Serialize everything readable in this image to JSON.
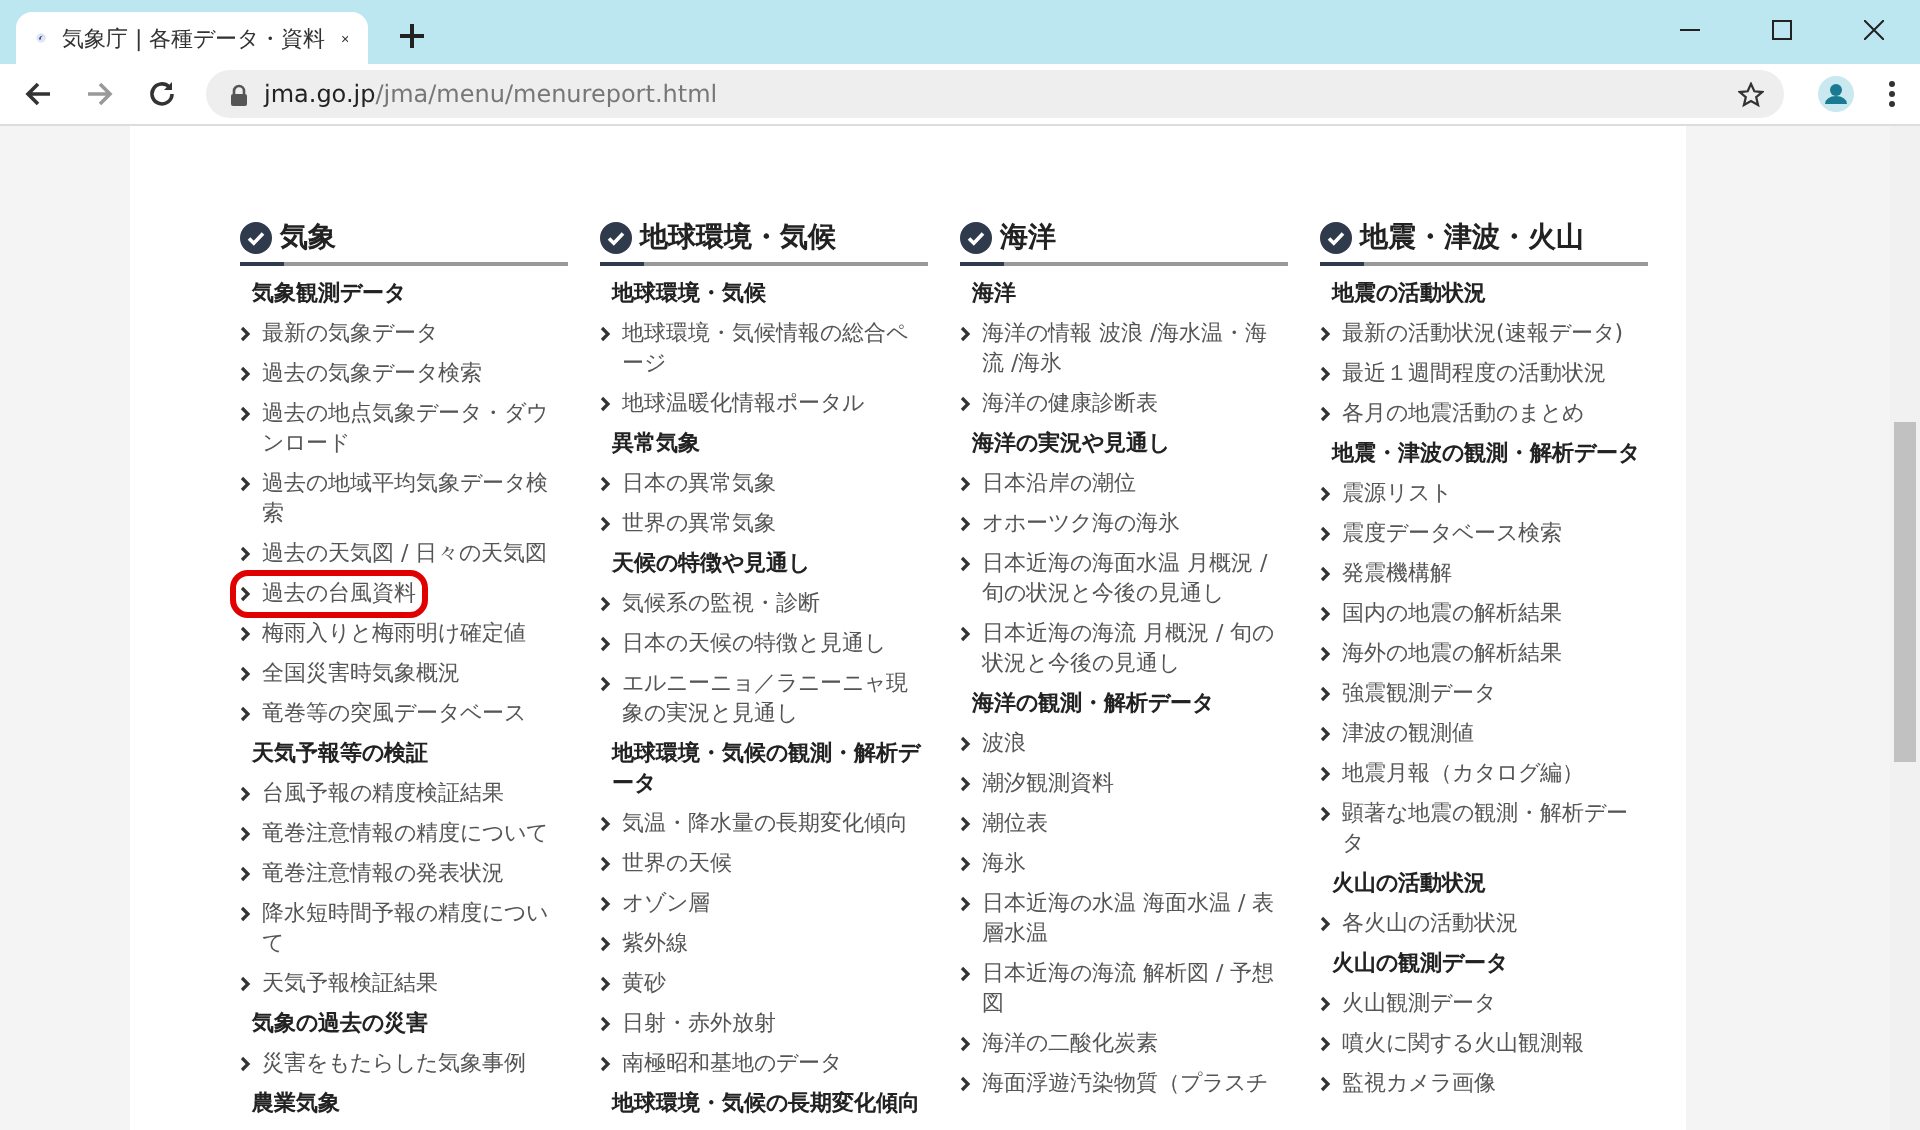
{
  "browser": {
    "tab": {
      "title": "気象庁 | 各種データ・資料",
      "selected": true
    },
    "url_host": "jma.go.jp",
    "url_path": "/jma/menu/menureport.html"
  },
  "sections": [
    {
      "title": "気象",
      "items": [
        {
          "kind": "heading",
          "text": "気象観測データ"
        },
        {
          "kind": "link",
          "text": "最新の気象データ",
          "highlighted": false
        },
        {
          "kind": "link",
          "text": "過去の気象データ検索",
          "highlighted": false
        },
        {
          "kind": "link",
          "text": "過去の地点気象データ・ダウンロード",
          "highlighted": false
        },
        {
          "kind": "link",
          "text": "過去の地域平均気象データ検索",
          "highlighted": false
        },
        {
          "kind": "link",
          "text": "過去の天気図 / 日々の天気図",
          "highlighted": false
        },
        {
          "kind": "link",
          "text": "過去の台風資料",
          "highlighted": true
        },
        {
          "kind": "link",
          "text": "梅雨入りと梅雨明け確定値",
          "highlighted": false
        },
        {
          "kind": "link",
          "text": "全国災害時気象概況",
          "highlighted": false
        },
        {
          "kind": "link",
          "text": "竜巻等の突風データベース",
          "highlighted": false
        },
        {
          "kind": "heading",
          "text": "天気予報等の検証"
        },
        {
          "kind": "link",
          "text": "台風予報の精度検証結果",
          "highlighted": false
        },
        {
          "kind": "link",
          "text": "竜巻注意情報の精度について",
          "highlighted": false
        },
        {
          "kind": "link",
          "text": "竜巻注意情報の発表状況",
          "highlighted": false
        },
        {
          "kind": "link",
          "text": "降水短時間予報の精度について",
          "highlighted": false
        },
        {
          "kind": "link",
          "text": "天気予報検証結果",
          "highlighted": false
        },
        {
          "kind": "heading",
          "text": "気象の過去の災害"
        },
        {
          "kind": "link",
          "text": "災害をもたらした気象事例",
          "highlighted": false
        },
        {
          "kind": "heading",
          "text": "農業気象"
        }
      ]
    },
    {
      "title": "地球環境・気候",
      "items": [
        {
          "kind": "heading",
          "text": "地球環境・気候"
        },
        {
          "kind": "link",
          "text": "地球環境・気候情報の総合ページ",
          "highlighted": false
        },
        {
          "kind": "link",
          "text": "地球温暖化情報ポータル",
          "highlighted": false
        },
        {
          "kind": "heading",
          "text": "異常気象"
        },
        {
          "kind": "link",
          "text": "日本の異常気象",
          "highlighted": false
        },
        {
          "kind": "link",
          "text": "世界の異常気象",
          "highlighted": false
        },
        {
          "kind": "heading",
          "text": "天候の特徴や見通し"
        },
        {
          "kind": "link",
          "text": "気候系の監視・診断",
          "highlighted": false
        },
        {
          "kind": "link",
          "text": "日本の天候の特徴と見通し",
          "highlighted": false
        },
        {
          "kind": "link",
          "text": "エルニーニョ／ラニーニャ現象の実況と見通し",
          "highlighted": false
        },
        {
          "kind": "heading",
          "text": "地球環境・気候の観測・解析データ"
        },
        {
          "kind": "link",
          "text": "気温・降水量の長期変化傾向",
          "highlighted": false
        },
        {
          "kind": "link",
          "text": "世界の天候",
          "highlighted": false
        },
        {
          "kind": "link",
          "text": "オゾン層",
          "highlighted": false
        },
        {
          "kind": "link",
          "text": "紫外線",
          "highlighted": false
        },
        {
          "kind": "link",
          "text": "黄砂",
          "highlighted": false
        },
        {
          "kind": "link",
          "text": "日射・赤外放射",
          "highlighted": false
        },
        {
          "kind": "link",
          "text": "南極昭和基地のデータ",
          "highlighted": false
        },
        {
          "kind": "heading",
          "text": "地球環境・気候の長期変化傾向"
        }
      ]
    },
    {
      "title": "海洋",
      "items": [
        {
          "kind": "heading",
          "text": "海洋"
        },
        {
          "kind": "link",
          "text": "海洋の情報 波浪 /海水温・海流 /海氷",
          "highlighted": false
        },
        {
          "kind": "link",
          "text": "海洋の健康診断表",
          "highlighted": false
        },
        {
          "kind": "heading",
          "text": "海洋の実況や見通し"
        },
        {
          "kind": "link",
          "text": "日本沿岸の潮位",
          "highlighted": false
        },
        {
          "kind": "link",
          "text": "オホーツク海の海氷",
          "highlighted": false
        },
        {
          "kind": "link",
          "text": "日本近海の海面水温 月概況 / 旬の状況と今後の見通し",
          "highlighted": false
        },
        {
          "kind": "link",
          "text": "日本近海の海流 月概況 / 旬の状況と今後の見通し",
          "highlighted": false
        },
        {
          "kind": "heading",
          "text": "海洋の観測・解析データ"
        },
        {
          "kind": "link",
          "text": "波浪",
          "highlighted": false
        },
        {
          "kind": "link",
          "text": "潮汐観測資料",
          "highlighted": false
        },
        {
          "kind": "link",
          "text": "潮位表",
          "highlighted": false
        },
        {
          "kind": "link",
          "text": "海氷",
          "highlighted": false
        },
        {
          "kind": "link",
          "text": "日本近海の水温 海面水温 / 表層水温",
          "highlighted": false
        },
        {
          "kind": "link",
          "text": "日本近海の海流 解析図 / 予想図",
          "highlighted": false
        },
        {
          "kind": "link",
          "text": "海洋の二酸化炭素",
          "highlighted": false
        },
        {
          "kind": "link",
          "text": "海面浮遊汚染物質（プラスチ",
          "highlighted": false
        }
      ]
    },
    {
      "title": "地震・津波・火山",
      "items": [
        {
          "kind": "heading",
          "text": "地震の活動状況"
        },
        {
          "kind": "link",
          "text": "最新の活動状況(速報データ)",
          "highlighted": false
        },
        {
          "kind": "link",
          "text": "最近１週間程度の活動状況",
          "highlighted": false
        },
        {
          "kind": "link",
          "text": "各月の地震活動のまとめ",
          "highlighted": false
        },
        {
          "kind": "heading",
          "text": "地震・津波の観測・解析データ"
        },
        {
          "kind": "link",
          "text": "震源リスト",
          "highlighted": false
        },
        {
          "kind": "link",
          "text": "震度データベース検索",
          "highlighted": false
        },
        {
          "kind": "link",
          "text": "発震機構解",
          "highlighted": false
        },
        {
          "kind": "link",
          "text": "国内の地震の解析結果",
          "highlighted": false
        },
        {
          "kind": "link",
          "text": "海外の地震の解析結果",
          "highlighted": false
        },
        {
          "kind": "link",
          "text": "強震観測データ",
          "highlighted": false
        },
        {
          "kind": "link",
          "text": "津波の観測値",
          "highlighted": false
        },
        {
          "kind": "link",
          "text": "地震月報（カタログ編）",
          "highlighted": false
        },
        {
          "kind": "link",
          "text": "顕著な地震の観測・解析データ",
          "highlighted": false
        },
        {
          "kind": "heading",
          "text": "火山の活動状況"
        },
        {
          "kind": "link",
          "text": "各火山の活動状況",
          "highlighted": false
        },
        {
          "kind": "heading",
          "text": "火山の観測データ"
        },
        {
          "kind": "link",
          "text": "火山観測データ",
          "highlighted": false
        },
        {
          "kind": "link",
          "text": "噴火に関する火山観測報",
          "highlighted": false
        },
        {
          "kind": "link",
          "text": "監視カメラ画像",
          "highlighted": false
        }
      ]
    }
  ]
}
